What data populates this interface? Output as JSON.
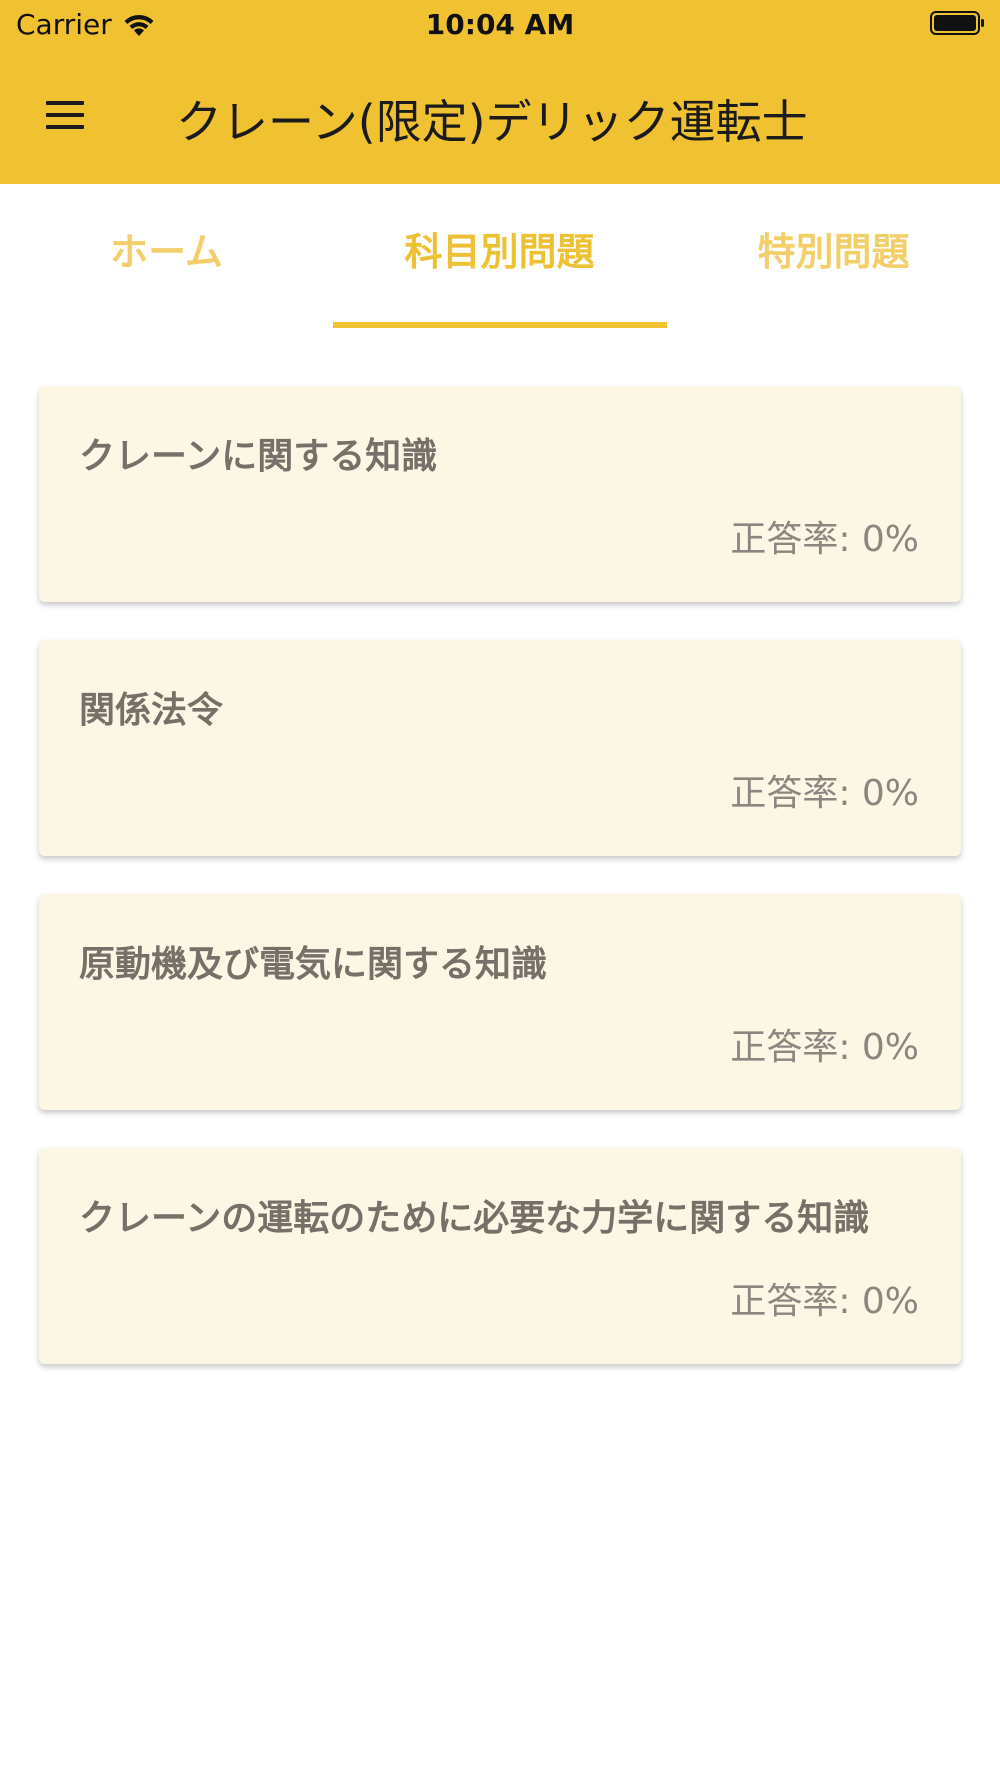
{
  "status_bar": {
    "carrier": "Carrier",
    "time": "10:04 AM",
    "icons": [
      "wifi-icon",
      "battery-icon"
    ]
  },
  "header": {
    "title": "クレーン(限定)デリック運転士",
    "menu_icon": "hamburger-menu-icon",
    "background_color": "#f0c232"
  },
  "tabs": [
    {
      "label": "ホーム",
      "active": false
    },
    {
      "label": "科目別問題",
      "active": true
    },
    {
      "label": "特別問題",
      "active": false
    }
  ],
  "subjects": [
    {
      "title": "クレーンに関する知識",
      "rate": "正答率: 0%"
    },
    {
      "title": "関係法令",
      "rate": "正答率: 0%"
    },
    {
      "title": "原動機及び電気に関する知識",
      "rate": "正答率: 0%"
    },
    {
      "title": "クレーンの運転のために必要な力学に関する知識",
      "rate": "正答率: 0%"
    }
  ],
  "colors": {
    "accent": "#f0c232",
    "card_background": "#fcf6e4",
    "tab_inactive": "#f3cf6a"
  }
}
